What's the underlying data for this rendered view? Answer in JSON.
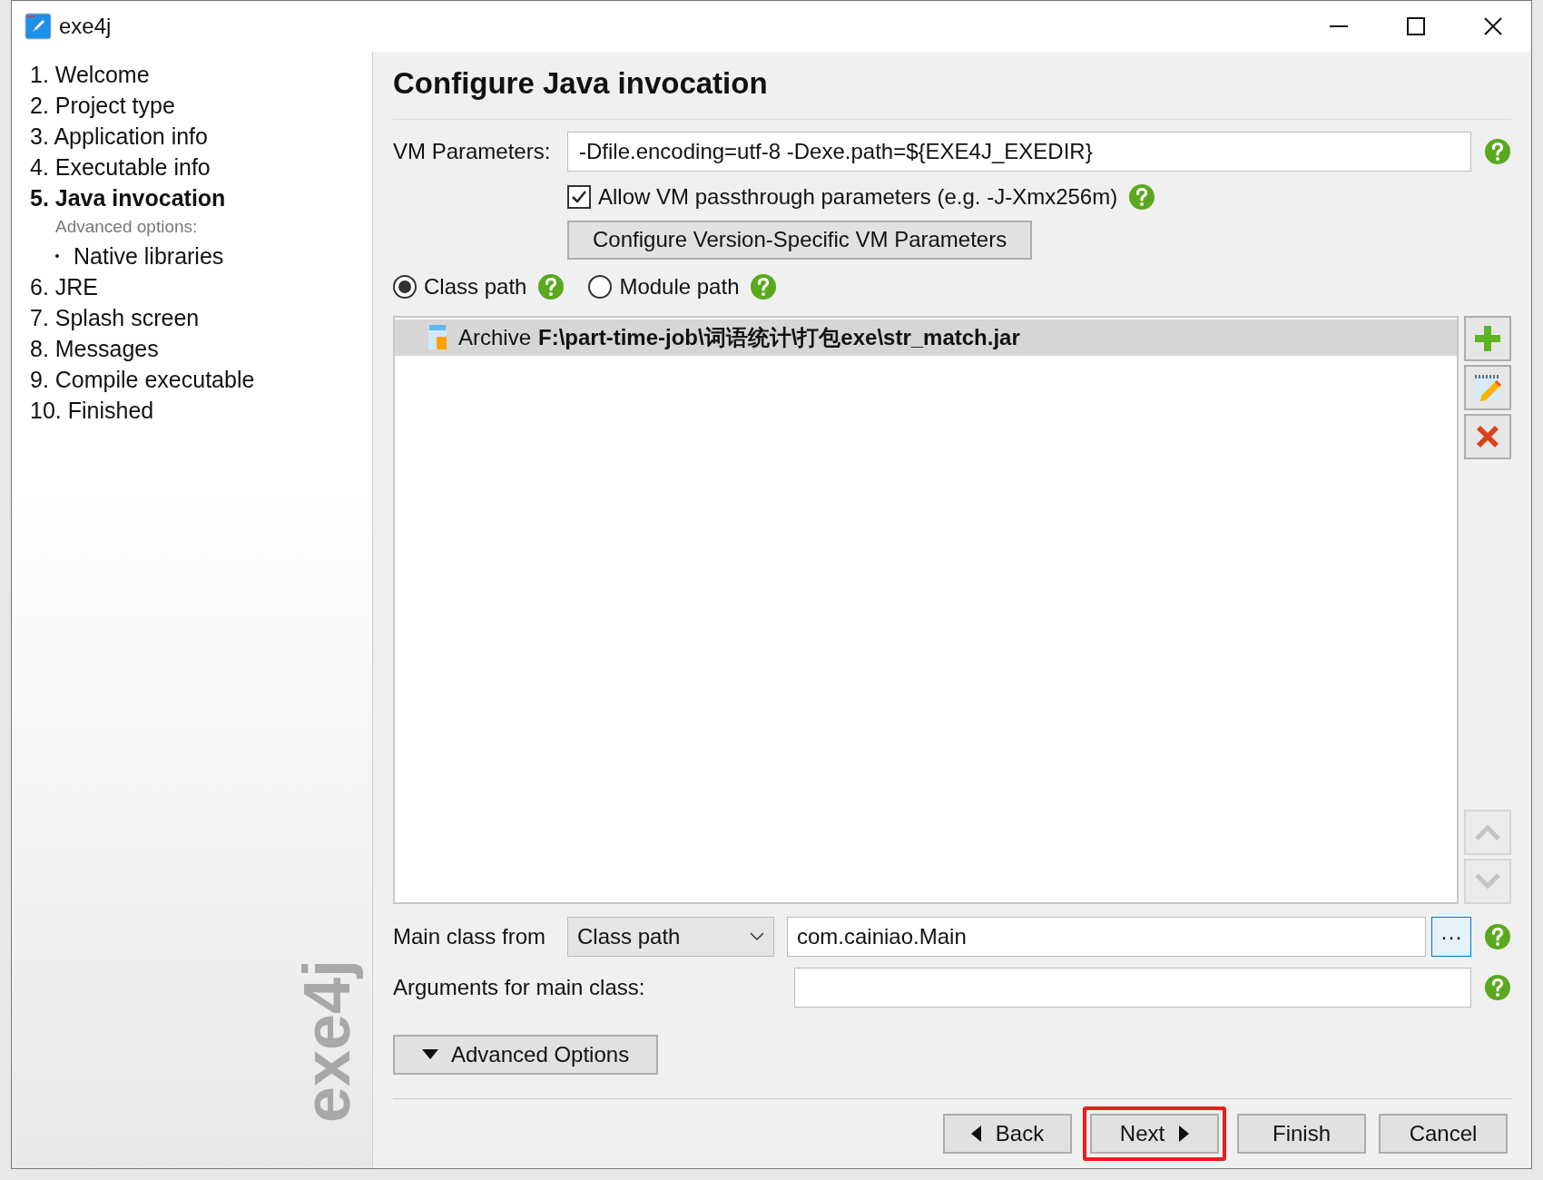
{
  "window": {
    "title": "exe4j"
  },
  "sidebar": {
    "items": [
      {
        "kind": "step",
        "label": "1. Welcome",
        "selected": false
      },
      {
        "kind": "step",
        "label": "2. Project type",
        "selected": false
      },
      {
        "kind": "step",
        "label": "3. Application info",
        "selected": false
      },
      {
        "kind": "step",
        "label": "4. Executable info",
        "selected": false
      },
      {
        "kind": "step",
        "label": "5. Java invocation",
        "selected": true
      },
      {
        "kind": "heading",
        "label": "Advanced options:"
      },
      {
        "kind": "sub",
        "label": "Native libraries",
        "selected": false
      },
      {
        "kind": "step",
        "label": "6. JRE",
        "selected": false
      },
      {
        "kind": "step",
        "label": "7. Splash screen",
        "selected": false
      },
      {
        "kind": "step",
        "label": "8. Messages",
        "selected": false
      },
      {
        "kind": "step",
        "label": "9. Compile executable",
        "selected": false
      },
      {
        "kind": "step",
        "label": "10. Finished",
        "selected": false
      }
    ],
    "logo": "exe4j"
  },
  "page": {
    "title": "Configure Java invocation",
    "vm_parameters": {
      "label": "VM Parameters:",
      "value": "-Dfile.encoding=utf-8 -Dexe.path=${EXE4J_EXEDIR}"
    },
    "passthrough": {
      "label": "Allow VM passthrough parameters (e.g. -J-Xmx256m)",
      "checked": true
    },
    "configure_button": "Configure Version-Specific VM Parameters",
    "path_mode": [
      {
        "label": "Class path",
        "selected": true
      },
      {
        "label": "Module path",
        "selected": false
      }
    ],
    "class_path": {
      "rows": [
        {
          "type": "Archive",
          "path": "F:\\part-time-job\\词语统计\\打包exe\\str_match.jar",
          "selected": true
        }
      ]
    },
    "list_tools": [
      {
        "kind": "add",
        "disabled": false
      },
      {
        "kind": "edit",
        "disabled": false
      },
      {
        "kind": "remove",
        "disabled": false
      },
      {
        "kind": "up",
        "disabled": true
      },
      {
        "kind": "down",
        "disabled": true
      }
    ],
    "main_class": {
      "label": "Main class from",
      "source": "Class path",
      "value": "com.cainiao.Main",
      "browse": "···"
    },
    "arguments": {
      "label": "Arguments for main class:"
    },
    "advanced_button": "Advanced Options"
  },
  "nav_buttons": [
    {
      "kind": "back",
      "label": "Back",
      "highlighted": false
    },
    {
      "kind": "next",
      "label": "Next",
      "highlighted": true
    },
    {
      "kind": "finish",
      "label": "Finish",
      "highlighted": false
    },
    {
      "kind": "cancel",
      "label": "Cancel",
      "highlighted": false
    }
  ]
}
